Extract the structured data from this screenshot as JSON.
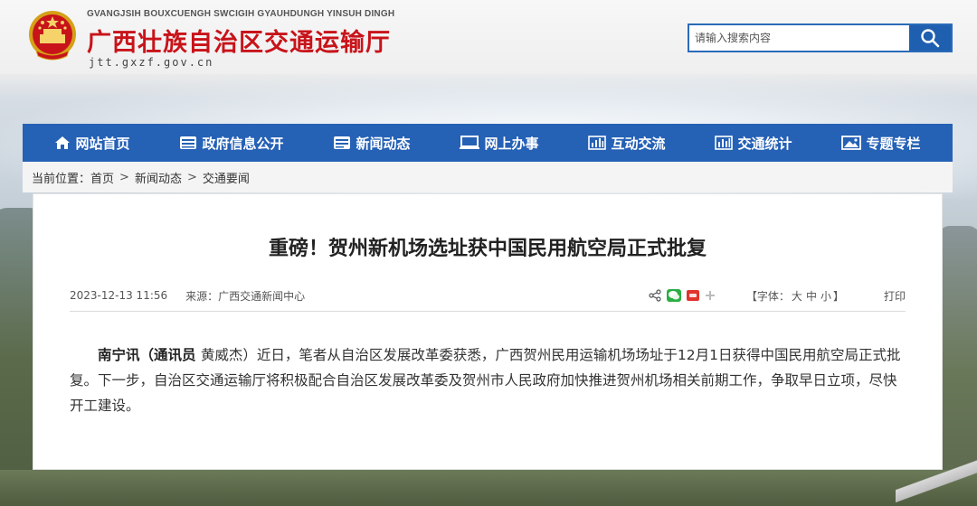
{
  "header": {
    "pinyin": "GVANGJSIH BOUXCUENGH SWCIGIH GYAUHDUNGH YINSUH DINGH",
    "title": "广西壮族自治区交通运输厅",
    "url": "jtt.gxzf.gov.cn"
  },
  "search": {
    "placeholder": "请输入搜索内容",
    "icon": "search-icon"
  },
  "nav": {
    "items": [
      {
        "label": "网站首页",
        "icon": "home-icon"
      },
      {
        "label": "政府信息公开",
        "icon": "info-icon"
      },
      {
        "label": "新闻动态",
        "icon": "news-icon"
      },
      {
        "label": "网上办事",
        "icon": "monitor-icon"
      },
      {
        "label": "互动交流",
        "icon": "chart-icon"
      },
      {
        "label": "交通统计",
        "icon": "stats-icon"
      },
      {
        "label": "专题专栏",
        "icon": "image-icon"
      }
    ]
  },
  "breadcrumb": {
    "prefix": "当前位置：",
    "items": [
      "首页",
      "新闻动态",
      "交通要闻"
    ],
    "separator": ">"
  },
  "article": {
    "title": "重磅！贺州新机场选址获中国民用航空局正式批复",
    "date": "2023-12-13 11:56",
    "source": "来源：广西交通新闻中心",
    "font_label_open": "【字体：",
    "font_sizes": [
      "大",
      "中",
      "小"
    ],
    "font_label_close": "】",
    "print": "打印",
    "lead": "南宁讯（通讯员 ",
    "reporter": "黄威杰",
    "body": "）近日，笔者从自治区发展改革委获悉，广西贺州民用运输机场场址于12月1日获得中国民用航空局正式批复。下一步，自治区交通运输厅将积极配合自治区发展改革委及贺州市人民政府加快推进贺州机场相关前期工作，争取早日立项，尽快开工建设。"
  },
  "colors": {
    "brand_red": "#c8131a",
    "nav_blue": "#2561b5",
    "search_blue": "#1e5fb0"
  }
}
